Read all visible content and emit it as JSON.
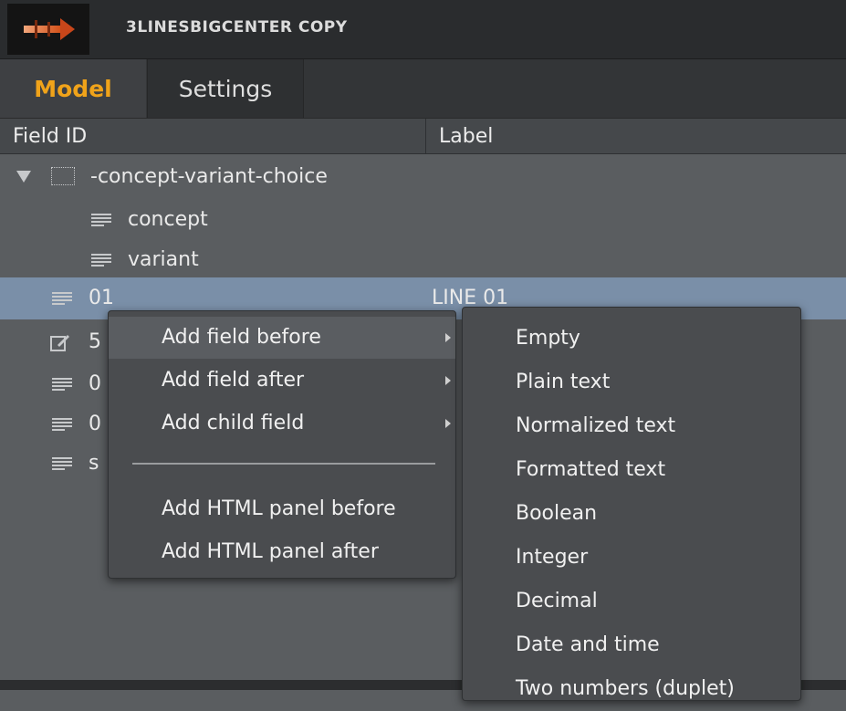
{
  "window": {
    "title": "3LINESBIGCENTER COPY"
  },
  "tabs": [
    {
      "label": "Model",
      "active": true
    },
    {
      "label": "Settings",
      "active": false
    }
  ],
  "columns": {
    "field_id": "Field ID",
    "label": "Label"
  },
  "tree_rows": [
    {
      "field_id": "-concept-variant-choice",
      "label": "",
      "icon": "folder-icon",
      "expanded": true
    },
    {
      "field_id": "concept",
      "label": "",
      "icon": "text-lines-icon"
    },
    {
      "field_id": "variant",
      "label": "",
      "icon": "text-lines-icon"
    },
    {
      "field_id": "01",
      "label": "LINE 01",
      "icon": "text-lines-icon",
      "selected": true
    },
    {
      "field_id": "5",
      "label": "",
      "icon": "edit-icon"
    },
    {
      "field_id": "0",
      "label": "",
      "icon": "text-lines-icon"
    },
    {
      "field_id": "0",
      "label": "",
      "icon": "text-lines-icon"
    },
    {
      "field_id": "s",
      "label": "",
      "icon": "text-lines-icon"
    }
  ],
  "context_menu": {
    "items": [
      {
        "label": "Add field before",
        "has_submenu": true,
        "highlighted": true
      },
      {
        "label": "Add field after",
        "has_submenu": true
      },
      {
        "label": "Add child field",
        "has_submenu": true
      },
      {
        "label": "Add HTML panel before"
      },
      {
        "label": "Add HTML panel after"
      }
    ]
  },
  "submenu": {
    "items": [
      {
        "label": "Empty"
      },
      {
        "label": "Plain text"
      },
      {
        "label": "Normalized text"
      },
      {
        "label": "Formatted text"
      },
      {
        "label": "Boolean"
      },
      {
        "label": "Integer"
      },
      {
        "label": "Decimal"
      },
      {
        "label": "Date and time"
      },
      {
        "label": "Two numbers (duplet)"
      }
    ]
  },
  "colors": {
    "accent": "#f0a31a",
    "selection": "#7a8fa8",
    "panel": "#5a5d60",
    "menu": "#4a4c4f"
  }
}
